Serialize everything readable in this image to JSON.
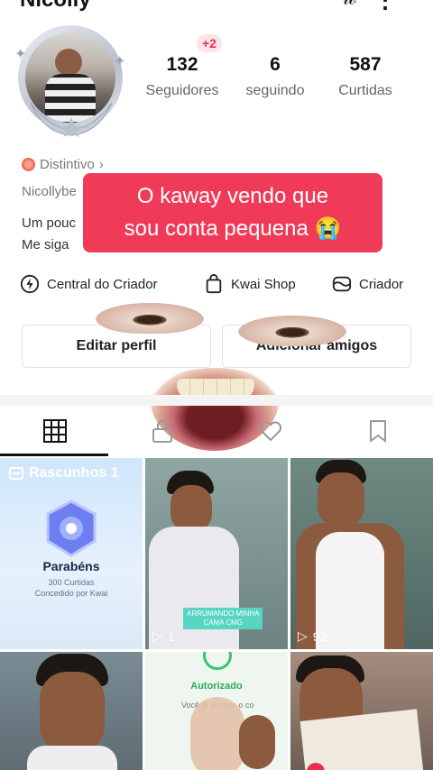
{
  "profile": {
    "name": "Nicolly",
    "followers": "132",
    "followers_label": "Seguidores",
    "followers_new": "+2",
    "following": "6",
    "following_label": "seguindo",
    "likes": "587",
    "likes_label": "Curtidas",
    "distintivo": "Distintivo",
    "username": "Nicollybe",
    "bio_line1": "Um pouc",
    "bio_line2": "Me siga"
  },
  "caption": {
    "line1": "O kaway vendo que",
    "line2": "sou conta pequena 😭"
  },
  "links": {
    "creator_center": "Central do Criador",
    "shop": "Kwai Shop",
    "creator": "Criador"
  },
  "buttons": {
    "edit_profile": "Editar perfil",
    "add_friends": "Adicionar amigos"
  },
  "grid": {
    "drafts_label": "Rascunhos 1",
    "drafts_title": "Parabéns",
    "drafts_sub1": "300 Curtidas",
    "drafts_sub2": "Concedido por Kwai",
    "cell2_tag_line1": "ARRUMANDO MINHA",
    "cell2_tag_line2": "CAMA CMG",
    "cell2_views": "1",
    "cell3_views": "92",
    "cell5_title": "Autorizado",
    "cell5_text": "Você já aceitou o co"
  },
  "colors": {
    "accent": "#ef3b57",
    "badge_bg": "#fde4e8",
    "badge_text": "#e8304e"
  }
}
